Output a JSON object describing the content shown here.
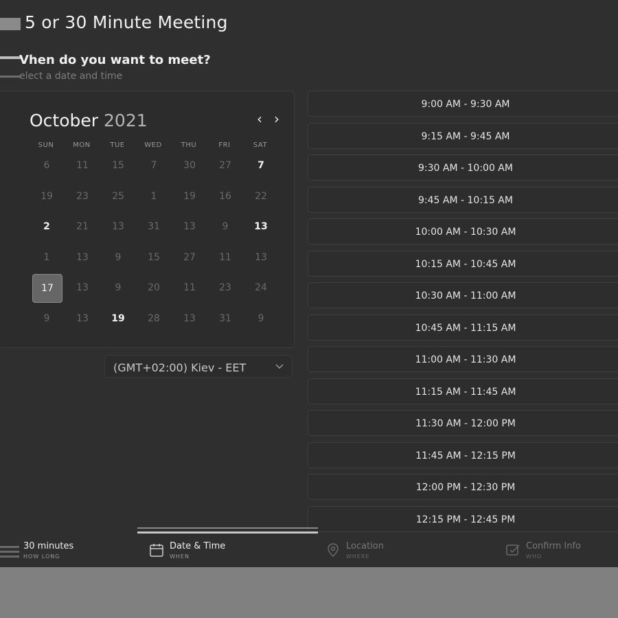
{
  "header": {
    "title": "5 or 30 Minute Meeting",
    "question": "Vhen do you want to meet?",
    "subtitle": "elect a date and time"
  },
  "calendar": {
    "month": "October",
    "year": "2021",
    "weekdays": [
      "SUN",
      "MON",
      "TUE",
      "WED",
      "THU",
      "FRI",
      "SAT"
    ],
    "weeks": [
      [
        "6",
        "11",
        "15",
        "7",
        "30",
        "27",
        "7"
      ],
      [
        "19",
        "23",
        "25",
        "1",
        "19",
        "16",
        "22"
      ],
      [
        "2",
        "21",
        "13",
        "31",
        "13",
        "9",
        "13"
      ],
      [
        "1",
        "13",
        "9",
        "15",
        "27",
        "11",
        "13"
      ],
      [
        "17",
        "13",
        "9",
        "20",
        "11",
        "23",
        "24"
      ],
      [
        "9",
        "13",
        "19",
        "28",
        "13",
        "31",
        "9"
      ]
    ],
    "selected_day": "17"
  },
  "timezone": {
    "label": "(GMT+02:00) Kiev - EET"
  },
  "slots": [
    "9:00 AM - 9:30 AM",
    "9:15 AM - 9:45 AM",
    "9:30 AM - 10:00 AM",
    "9:45 AM - 10:15 AM",
    "10:00 AM - 10:30 AM",
    "10:15 AM - 10:45 AM",
    "10:30 AM - 11:00 AM",
    "10:45 AM - 11:15 AM",
    "11:00 AM - 11:30 AM",
    "11:15 AM - 11:45 AM",
    "11:30 AM - 12:00 PM",
    "11:45 AM - 12:15 PM",
    "12:00 PM - 12:30 PM",
    "12:15 PM - 12:45 PM"
  ],
  "steps": [
    {
      "label": "30 minutes",
      "sub": "HOW LONG",
      "icon": "bars-icon"
    },
    {
      "label": "Date & Time",
      "sub": "WHEN",
      "icon": "calendar-icon"
    },
    {
      "label": "Location",
      "sub": "WHERE",
      "icon": "location-pin-icon"
    },
    {
      "label": "Confirm Info",
      "sub": "WHO",
      "icon": "confirm-icon"
    }
  ],
  "progress": {
    "current_step": 2,
    "total_steps": 4
  }
}
